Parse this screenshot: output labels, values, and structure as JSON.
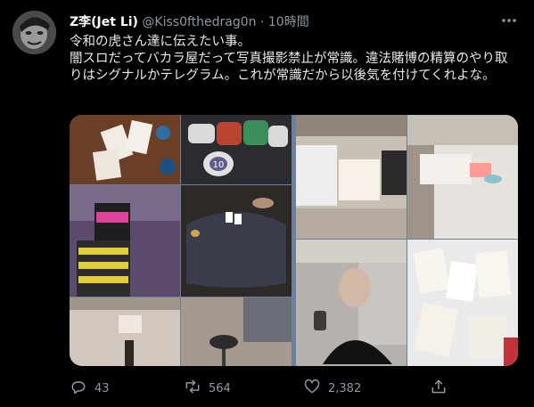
{
  "author": {
    "name": "Z李(Jet Li)",
    "handle": "@Kiss0fthedrag0n",
    "separator": "·",
    "time": "10時間"
  },
  "tweet": {
    "line1": "令和の虎さん達に伝えたい事。",
    "line2": "闇スロだってバカラ屋だって写真撮影禁止が常識。違法賭博の精算のやり取りはシグナルかテレグラム。これが常識だから以後気を付けてくれよな。"
  },
  "media": {
    "photos": [
      "poker-cards-table-photo",
      "poker-chips-photo",
      "chip-stack-photo",
      "poker-table-photo",
      "room-interior-photo",
      "room-chairs-photo",
      "cash-counting-photo",
      "card-game-table-photo",
      "man-selfie-photo",
      "playing-cards-closeup-photo"
    ],
    "chip_label": "10"
  },
  "actions": {
    "reply_count": "43",
    "retweet_count": "564",
    "like_count": "2,382"
  },
  "icons": [
    "more-icon",
    "reply-icon",
    "retweet-icon",
    "like-icon",
    "share-icon"
  ],
  "colors": {
    "background": "#000000",
    "text": "#e7e9ea",
    "secondary": "#8b98a5"
  }
}
